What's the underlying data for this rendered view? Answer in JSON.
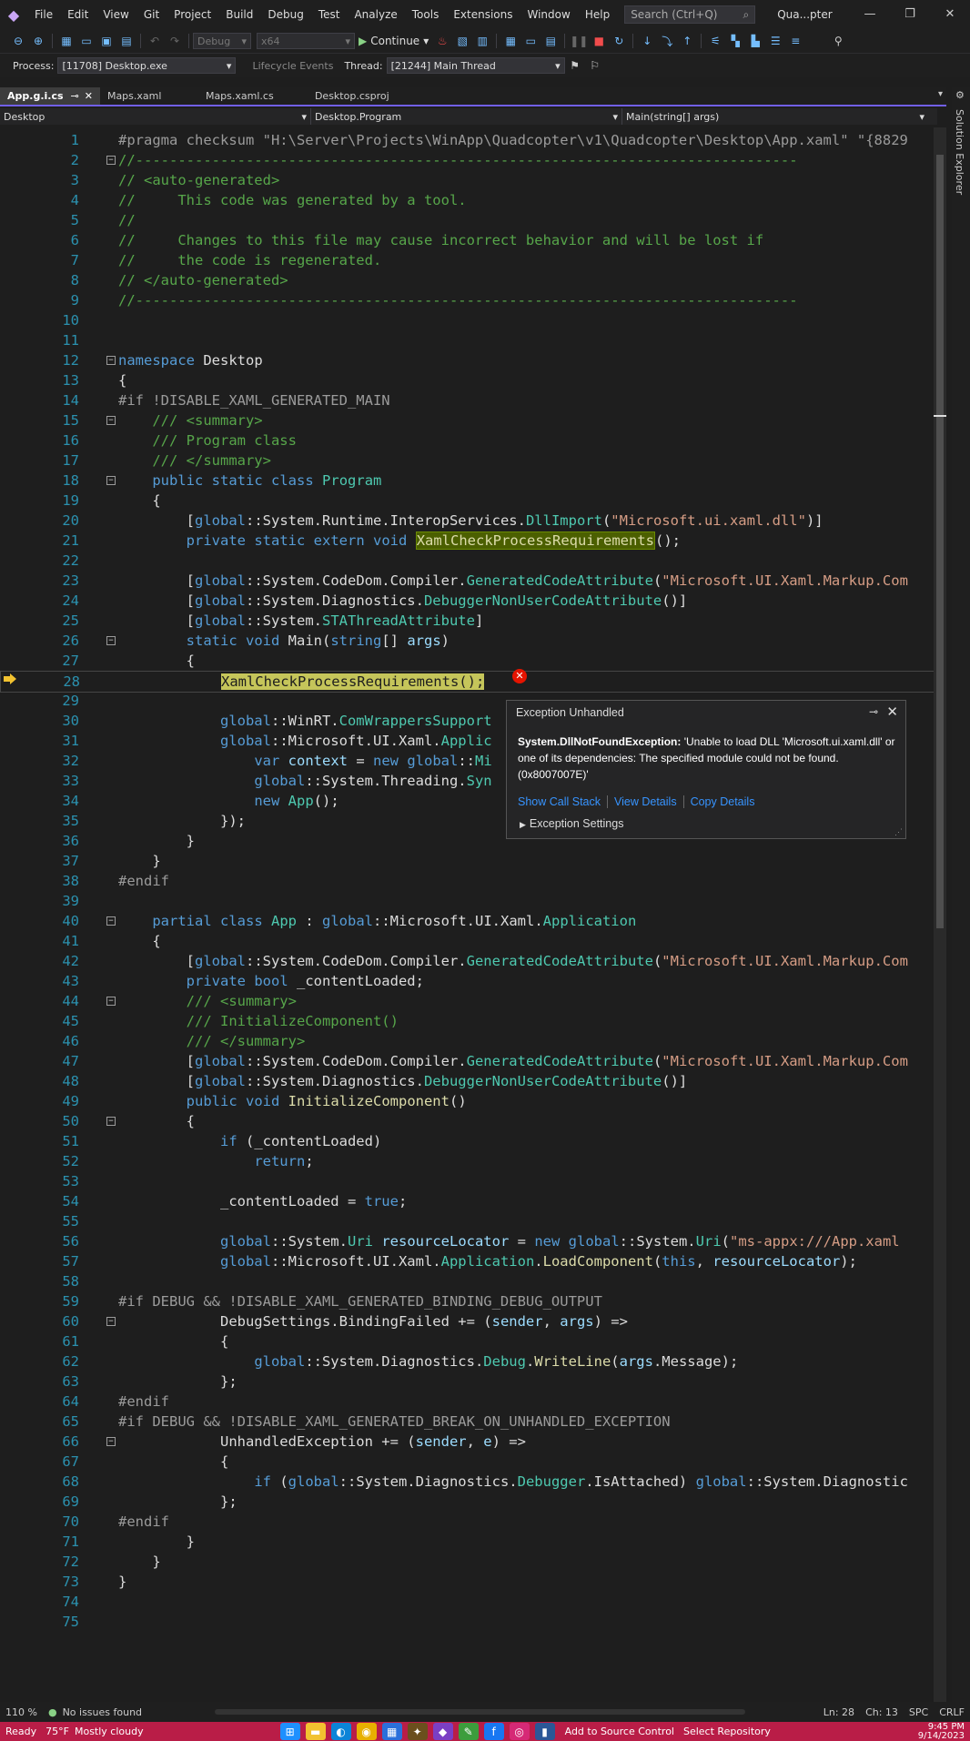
{
  "menu": {
    "items": [
      "File",
      "Edit",
      "View",
      "Git",
      "Project",
      "Build",
      "Debug",
      "Test",
      "Analyze",
      "Tools",
      "Extensions",
      "Window",
      "Help"
    ],
    "search_placeholder": "Search (Ctrl+Q)",
    "solution_name": "Qua...pter"
  },
  "toolbar": {
    "config": "Debug",
    "platform": "x64",
    "continue_label": "Continue"
  },
  "debugbar": {
    "process_label": "Process:",
    "process_value": "[11708] Desktop.exe",
    "lifecycle_label": "Lifecycle Events",
    "thread_label": "Thread:",
    "thread_value": "[21244] Main Thread"
  },
  "tabs": [
    {
      "label": "App.g.i.cs",
      "active": true
    },
    {
      "label": "Maps.xaml",
      "active": false
    },
    {
      "label": "Maps.xaml.cs",
      "active": false
    },
    {
      "label": "Desktop.csproj",
      "active": false
    }
  ],
  "navbar": {
    "project": "Desktop",
    "type": "Desktop.Program",
    "member": "Main(string[] args)"
  },
  "side_panel": {
    "label": "Solution Explorer"
  },
  "code_lines": [
    "#pragma checksum \"H:\\Server\\Projects\\WinApp\\Quadcopter\\v1\\Quadcopter\\Desktop\\App.xaml\" \"{8829",
    "//------------------------------------------------------------------------------",
    "// <auto-generated>",
    "//     This code was generated by a tool.",
    "//",
    "//     Changes to this file may cause incorrect behavior and will be lost if",
    "//     the code is regenerated.",
    "// </auto-generated>",
    "//------------------------------------------------------------------------------",
    "",
    "",
    "namespace Desktop",
    "{",
    "#if !DISABLE_XAML_GENERATED_MAIN",
    "    /// <summary>",
    "    /// Program class",
    "    /// </summary>",
    "    public static class Program",
    "    {",
    "        [global::System.Runtime.InteropServices.DllImport(\"Microsoft.ui.xaml.dll\")]",
    "        private static extern void XamlCheckProcessRequirements();",
    "",
    "        [global::System.CodeDom.Compiler.GeneratedCodeAttribute(\"Microsoft.UI.Xaml.Markup.Com",
    "        [global::System.Diagnostics.DebuggerNonUserCodeAttribute()]",
    "        [global::System.STAThreadAttribute]",
    "        static void Main(string[] args)",
    "        {",
    "            XamlCheckProcessRequirements();",
    "",
    "            global::WinRT.ComWrappersSupport",
    "            global::Microsoft.UI.Xaml.Applic",
    "                var context = new global::Mi",
    "                global::System.Threading.Syn",
    "                new App();",
    "            });",
    "        }",
    "    }",
    "#endif",
    "",
    "    partial class App : global::Microsoft.UI.Xaml.Application",
    "    {",
    "        [global::System.CodeDom.Compiler.GeneratedCodeAttribute(\"Microsoft.UI.Xaml.Markup.Com",
    "        private bool _contentLoaded;",
    "        /// <summary>",
    "        /// InitializeComponent()",
    "        /// </summary>",
    "        [global::System.CodeDom.Compiler.GeneratedCodeAttribute(\"Microsoft.UI.Xaml.Markup.Com",
    "        [global::System.Diagnostics.DebuggerNonUserCodeAttribute()]",
    "        public void InitializeComponent()",
    "        {",
    "            if (_contentLoaded)",
    "                return;",
    "",
    "            _contentLoaded = true;",
    "",
    "            global::System.Uri resourceLocator = new global::System.Uri(\"ms-appx:///App.xaml",
    "            global::Microsoft.UI.Xaml.Application.LoadComponent(this, resourceLocator);",
    "",
    "#if DEBUG && !DISABLE_XAML_GENERATED_BINDING_DEBUG_OUTPUT",
    "            DebugSettings.BindingFailed += (sender, args) =>",
    "            {",
    "                global::System.Diagnostics.Debug.WriteLine(args.Message);",
    "            };",
    "#endif",
    "#if DEBUG && !DISABLE_XAML_GENERATED_BREAK_ON_UNHANDLED_EXCEPTION",
    "            UnhandledException += (sender, e) =>",
    "            {",
    "                if (global::System.Diagnostics.Debugger.IsAttached) global::System.Diagnostic",
    "            };",
    "#endif",
    "        }",
    "    }",
    "}",
    "",
    ""
  ],
  "exception_popup": {
    "title": "Exception Unhandled",
    "exception_type": "System.DllNotFoundException:",
    "message": "'Unable to load DLL 'Microsoft.ui.xaml.dll' or one of its dependencies: The specified module could not be found. (0x8007007E)'",
    "links": [
      "Show Call Stack",
      "View Details",
      "Copy Details"
    ],
    "settings": "Exception Settings"
  },
  "statusbar": {
    "zoom": "110 %",
    "issues": "No issues found",
    "ln": "Ln: 28",
    "ch": "Ch: 13",
    "spc": "SPC",
    "crlf": "CRLF",
    "ready": "Ready",
    "source_control": "Add to Source Control",
    "repo": "Select Repository"
  },
  "taskbar": {
    "temp": "75°F",
    "weather": "Mostly cloudy",
    "time": "9:45 PM",
    "date": "9/14/2023"
  },
  "colors": {
    "accent": "#7160e8",
    "error": "#e51400",
    "taskbar": "#b91d47"
  }
}
